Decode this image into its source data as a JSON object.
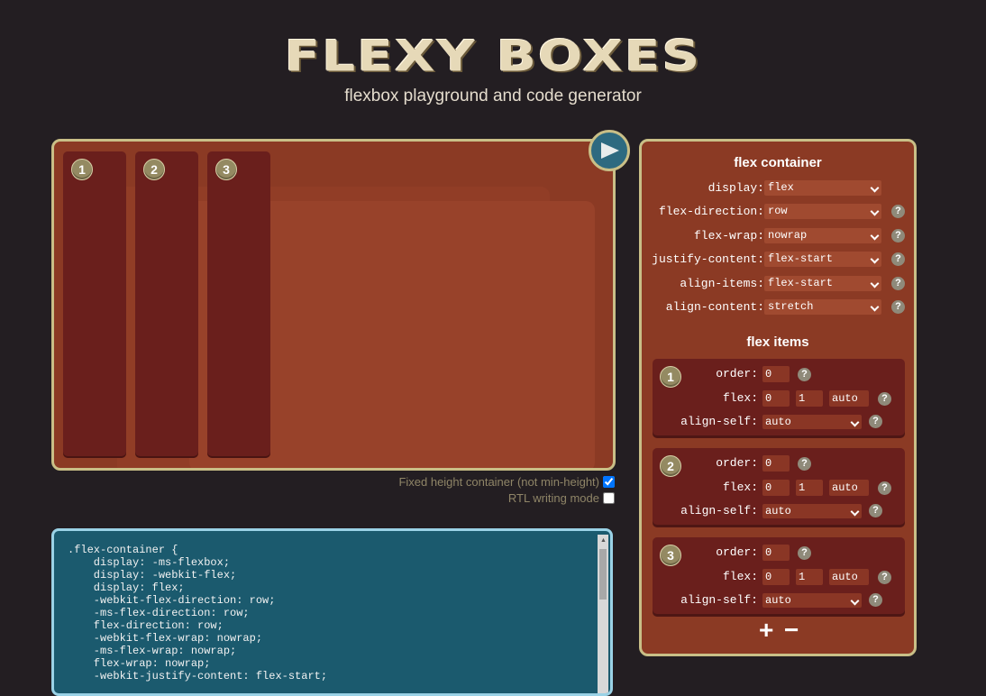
{
  "header": {
    "logo_text": "FLEXY BOXES",
    "subtitle": "flexbox playground and code generator"
  },
  "playground": {
    "items": [
      {
        "number": "1"
      },
      {
        "number": "2"
      },
      {
        "number": "3"
      }
    ],
    "play_icon": "play-triangle-icon"
  },
  "options": {
    "fixed_height_label": "Fixed height container (not min-height)",
    "fixed_height_checked": true,
    "rtl_label": "RTL writing mode",
    "rtl_checked": false
  },
  "code": {
    "lines": [
      ".flex-container {",
      "    display: -ms-flexbox;",
      "    display: -webkit-flex;",
      "    display: flex;",
      "    -webkit-flex-direction: row;",
      "    -ms-flex-direction: row;",
      "    flex-direction: row;",
      "    -webkit-flex-wrap: nowrap;",
      "    -ms-flex-wrap: nowrap;",
      "    flex-wrap: nowrap;",
      "    -webkit-justify-content: flex-start;"
    ]
  },
  "container_panel": {
    "title": "flex container",
    "help_symbol": "?",
    "rows": [
      {
        "label": "display:",
        "value": "flex",
        "help": false
      },
      {
        "label": "flex-direction:",
        "value": "row",
        "help": true
      },
      {
        "label": "flex-wrap:",
        "value": "nowrap",
        "help": true
      },
      {
        "label": "justify-content:",
        "value": "flex-start",
        "help": true
      },
      {
        "label": "align-items:",
        "value": "flex-start",
        "help": true
      },
      {
        "label": "align-content:",
        "value": "stretch",
        "help": true
      }
    ]
  },
  "items_panel": {
    "title": "flex items",
    "order_label": "order:",
    "flex_label": "flex:",
    "align_self_label": "align-self:",
    "items": [
      {
        "number": "1",
        "order": "0",
        "grow": "0",
        "shrink": "1",
        "basis": "auto",
        "align_self": "auto"
      },
      {
        "number": "2",
        "order": "0",
        "grow": "0",
        "shrink": "1",
        "basis": "auto",
        "align_self": "auto"
      },
      {
        "number": "3",
        "order": "0",
        "grow": "0",
        "shrink": "1",
        "basis": "auto",
        "align_self": "auto"
      }
    ],
    "add_label": "+",
    "remove_label": "−"
  },
  "colors": {
    "background": "#231e22",
    "panel": "#8b3a24",
    "item": "#6a1f1c",
    "border": "#c9bf87",
    "code_bg": "#1b5a6e"
  }
}
